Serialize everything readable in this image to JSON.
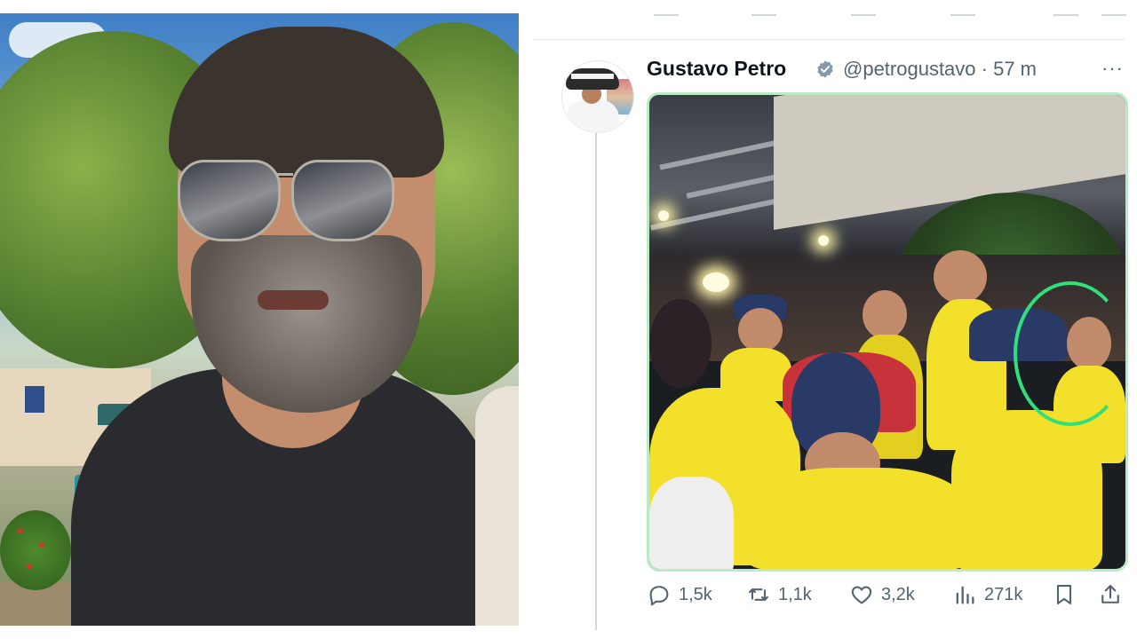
{
  "tweet": {
    "author_name": "Gustavo Petro",
    "handle_time": "@petrogustavo · 57 m",
    "more_label": "···",
    "stats": {
      "replies": "1,5k",
      "retweets": "1,1k",
      "likes": "3,2k",
      "views": "271k"
    }
  },
  "icons": {
    "verified": "verified-badge-icon",
    "reply": "reply-icon",
    "retweet": "retweet-icon",
    "like": "heart-icon",
    "views": "views-icon",
    "bookmark": "bookmark-icon",
    "share": "share-icon"
  },
  "colors": {
    "text_primary": "#0f1419",
    "text_secondary": "#536471",
    "verified": "#829aab",
    "media_border": "#b9ecc4",
    "highlight_circle": "#2fe07b",
    "jersey_yellow": "#f2e02a"
  }
}
